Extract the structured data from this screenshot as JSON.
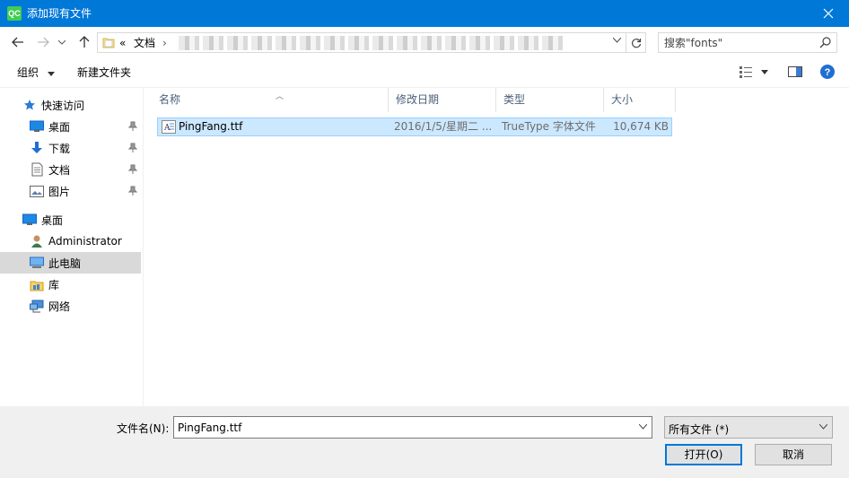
{
  "window": {
    "app_icon_text": "QC",
    "title": "添加现有文件"
  },
  "nav": {
    "breadcrumb_prefix": "«",
    "breadcrumb_root": "文档",
    "breadcrumb_sep": "›"
  },
  "search": {
    "placeholder": "搜索\"fonts\""
  },
  "toolbar": {
    "organize_label": "组织",
    "new_folder_label": "新建文件夹"
  },
  "sidebar": {
    "quick_access": "快速访问",
    "items_quick": [
      {
        "label": "桌面",
        "icon": "desktop-icon"
      },
      {
        "label": "下载",
        "icon": "download-icon"
      },
      {
        "label": "文档",
        "icon": "document-icon"
      },
      {
        "label": "图片",
        "icon": "pictures-icon"
      }
    ],
    "desktop": "桌面",
    "administrator": "Administrator",
    "this_pc": "此电脑",
    "library": "库",
    "network": "网络"
  },
  "columns": {
    "name": "名称",
    "modified": "修改日期",
    "type": "类型",
    "size": "大小"
  },
  "files": [
    {
      "name": "PingFang.ttf",
      "modified": "2016/1/5/星期二 ...",
      "type": "TrueType 字体文件",
      "size": "10,674 KB"
    }
  ],
  "bottom": {
    "filename_label": "文件名(N):",
    "filename_value": "PingFang.ttf",
    "filetype_value": "所有文件 (*)",
    "open_label": "打开(O)",
    "cancel_label": "取消"
  },
  "colors": {
    "titlebar": "#0078d7",
    "selection": "#cce8ff",
    "selection_border": "#99d1ff",
    "bottom_bg": "#f0f0f0"
  }
}
